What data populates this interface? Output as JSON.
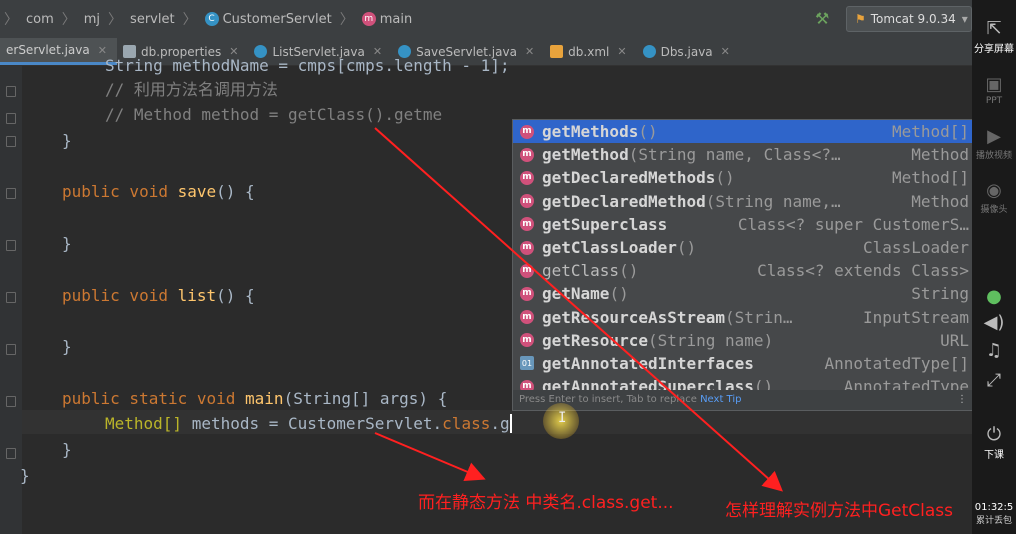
{
  "breadcrumb": {
    "items": [
      {
        "label": "com"
      },
      {
        "label": "mj"
      },
      {
        "label": "servlet"
      },
      {
        "label": "CustomerServlet"
      },
      {
        "label": "main"
      }
    ]
  },
  "run_config": {
    "label": "Tomcat 9.0.34",
    "arrow": "▾"
  },
  "tabs": [
    {
      "label": "erServlet.java",
      "active": true,
      "color": "#3592c4"
    },
    {
      "label": "db.properties",
      "color": "#9aa7b0"
    },
    {
      "label": "ListServlet.java",
      "color": "#3592c4"
    },
    {
      "label": "SaveServlet.java",
      "color": "#3592c4"
    },
    {
      "label": "db.xml",
      "color": "#e8a33c"
    },
    {
      "label": "Dbs.java",
      "color": "#3592c4"
    }
  ],
  "code": {
    "line0": "String methodName = cmps[cmps.length - 1];",
    "line1": "// 利用方法名调用方法",
    "line2": "// Method method = getClass().getme",
    "line3": "}",
    "line4_kw": "public void ",
    "line4_fn": "save",
    "line4_rest": "() {",
    "line5": "}",
    "line6_kw": "public void ",
    "line6_fn": "list",
    "line6_rest": "() {",
    "line7": "}",
    "line8_kw": "public static void ",
    "line8_fn": "main",
    "line8_rest": "(String[] args) {",
    "line9_type": "Method[] ",
    "line9_var": "methods",
    "line9_rest": " = CustomerServlet.",
    "line9_kw": "class",
    "line9_end": ".g",
    "line10": "}",
    "line11": "}"
  },
  "completion": {
    "items": [
      {
        "name": "getMethods",
        "params": "()",
        "type": "Method[]",
        "badge": "m"
      },
      {
        "name": "getMethod",
        "params": "(String name, Class<?…",
        "type": "Method",
        "badge": "m"
      },
      {
        "name": "getDeclaredMethods",
        "params": "()",
        "type": "Method[]",
        "badge": "m"
      },
      {
        "name": "getDeclaredMethod",
        "params": "(String name,…",
        "type": "Method",
        "badge": "m"
      },
      {
        "name": "getSuperclass",
        "params": "",
        "type": "Class<? super CustomerS…",
        "badge": "m"
      },
      {
        "name": "getClassLoader",
        "params": "()",
        "type": "ClassLoader",
        "badge": "m"
      },
      {
        "name": "getClass",
        "params": "()",
        "type": "Class<? extends Class>",
        "badge": "m"
      },
      {
        "name": "getName",
        "params": "()",
        "type": "String",
        "badge": "m"
      },
      {
        "name": "getResourceAsStream",
        "params": "(Strin…",
        "type": "InputStream",
        "badge": "m"
      },
      {
        "name": "getResource",
        "params": "(String name)",
        "type": "URL",
        "badge": "m"
      },
      {
        "name": "getAnnotatedInterfaces",
        "params": "",
        "type": "AnnotatedType[]",
        "badge": "m"
      },
      {
        "name": "getAnnotatedSuperclass",
        "params": "()",
        "type": "AnnotatedType",
        "badge": "m"
      }
    ],
    "footer_text": "Press Enter to insert, Tab to replace",
    "footer_tip": "Next Tip"
  },
  "annotations": {
    "static_note": "而在静态方法 中类名.class.get...",
    "instance_note": "怎样理解实例方法中GetClass"
  },
  "sidebar": {
    "share": "分享屏幕",
    "ppt": "PPT",
    "video": "播放视频",
    "camera": "摄像头",
    "download": "下课",
    "time": "01:32:5",
    "time_label": "累计丢包"
  },
  "colors": {
    "accent": "#2f65ca",
    "annotation": "#ff2020"
  }
}
